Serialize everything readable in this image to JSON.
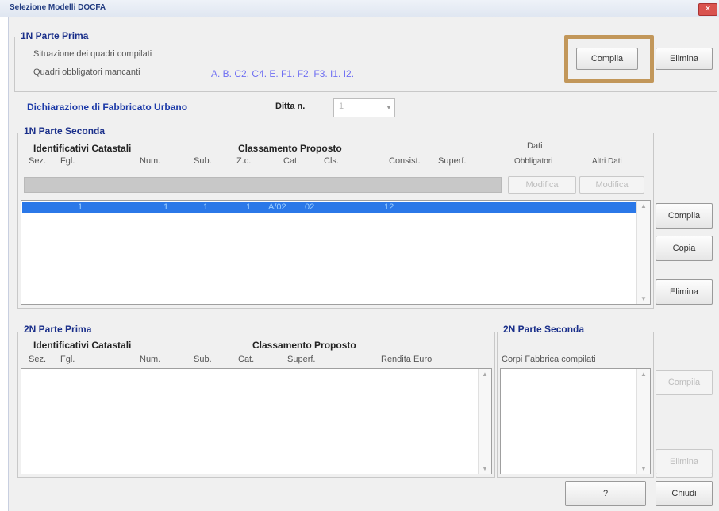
{
  "window": {
    "title": "Selezione Modelli DOCFA"
  },
  "parte_prima_1n": {
    "legend": "1N Parte Prima",
    "situazione_label": "Situazione dei quadri compilati",
    "mancanti_label": "Quadri obbligatori mancanti",
    "mancanti_value": "A. B. C2. C4. E. F1. F2. F3. I1. I2.",
    "compila_label": "Compila",
    "elimina_label": "Elimina"
  },
  "dichiarazione": {
    "title": "Dichiarazione di Fabbricato Urbano",
    "ditta_label": "Ditta n.",
    "ditta_value": "1"
  },
  "parte_seconda_1n": {
    "legend": "1N Parte Seconda",
    "group1": "Identificativi Catastali",
    "group2": "Classamento Proposto",
    "dati_obbl_line1": "Dati",
    "dati_obbl_line2": "Obbligatori",
    "altri_dati": "Altri Dati",
    "columns": [
      "Sez.",
      "Fgl.",
      "Num.",
      "Sub.",
      "Z.c.",
      "Cat.",
      "Cls.",
      "Consist.",
      "Superf."
    ],
    "modifica_1": "Modifica",
    "modifica_2": "Modifica",
    "row": [
      "1",
      "1",
      "1",
      "1",
      "A/02",
      "02",
      "12"
    ],
    "compila_label": "Compila",
    "copia_label": "Copia",
    "elimina_label": "Elimina"
  },
  "parte_prima_2n": {
    "legend": "2N Parte Prima",
    "group1": "Identificativi Catastali",
    "group2": "Classamento Proposto",
    "columns": [
      "Sez.",
      "Fgl.",
      "Num.",
      "Sub.",
      "Cat.",
      "Superf.",
      "Rendita Euro"
    ]
  },
  "parte_seconda_2n": {
    "legend": "2N Parte Seconda",
    "corpi_label": "Corpi Fabbrica compilati",
    "compila_label": "Compila",
    "elimina_label": "Elimina"
  },
  "footer": {
    "help_label": "?",
    "chiudi_label": "Chiudi"
  },
  "colors": {
    "accent": "#c2975a",
    "selection": "#2b78e8",
    "label_blue": "#1c3aa8"
  }
}
